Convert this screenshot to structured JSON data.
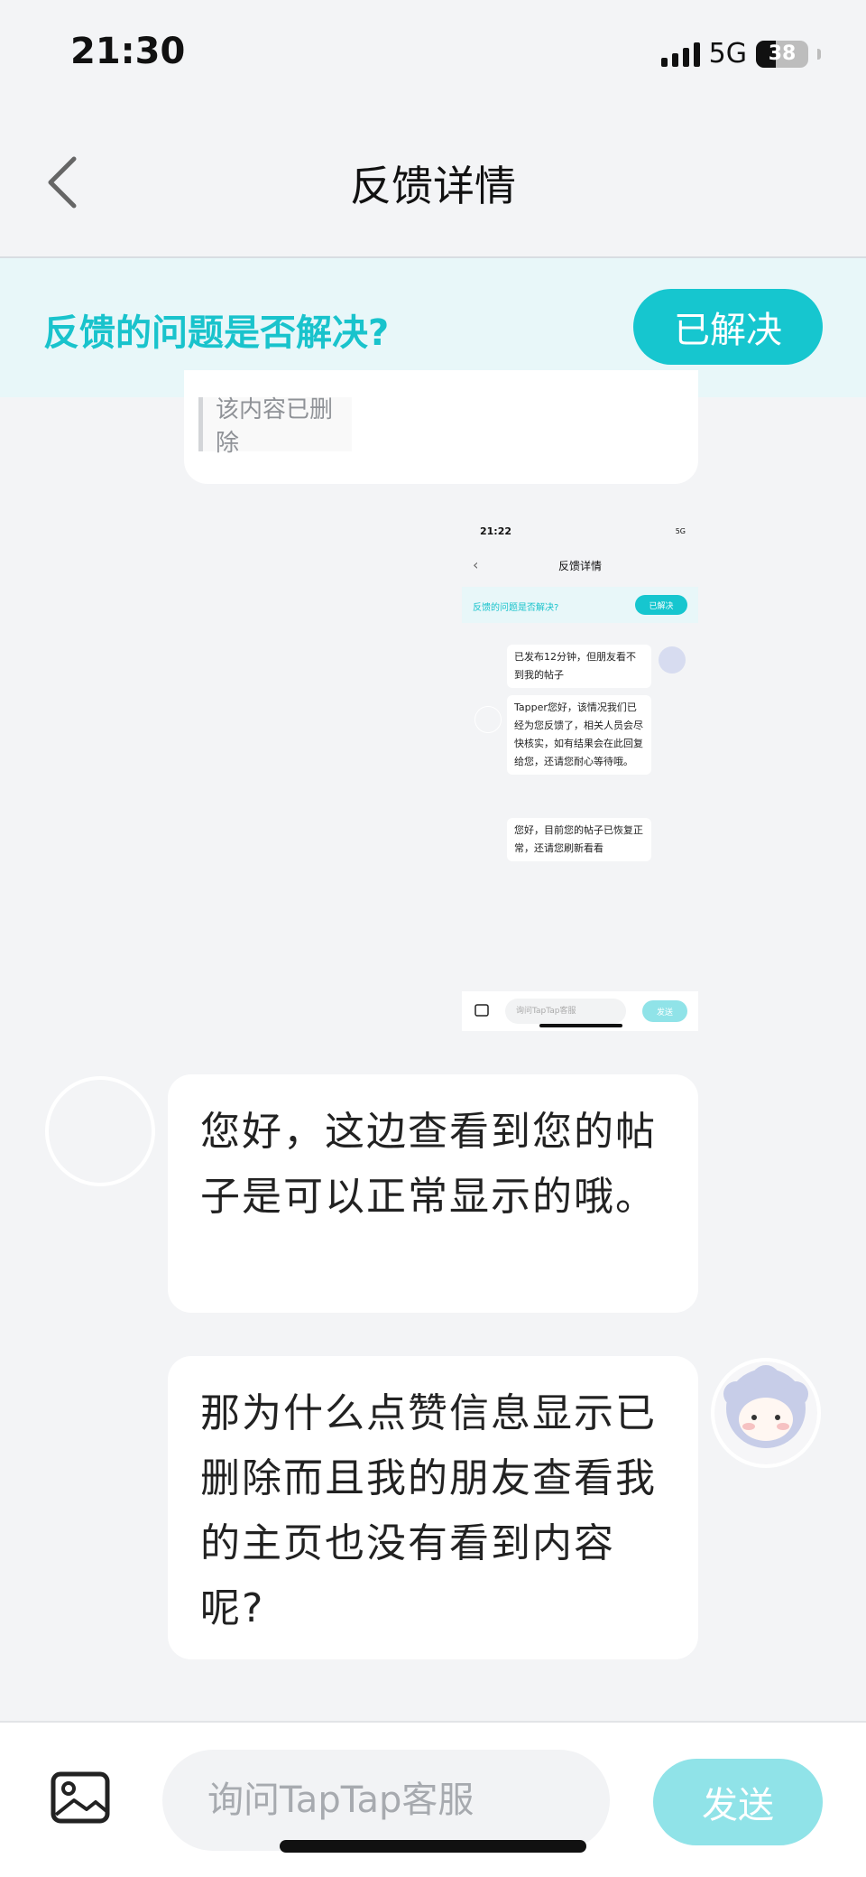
{
  "status_bar": {
    "time": "21:30",
    "network": "5G",
    "battery": "38"
  },
  "header": {
    "title": "反馈详情",
    "back_icon": "chevron-left-icon"
  },
  "banner": {
    "question": "反馈的问题是否解决?",
    "resolved_label": "已解决",
    "accent": "#16c6cf"
  },
  "messages": {
    "deleted_notice": "该内容已删除",
    "screenshot": {
      "time": "21:22",
      "network": "5G",
      "title": "反馈详情",
      "question": "反馈的问题是否解决?",
      "resolved_label": "已解决",
      "msg1": "已发布12分钟，但朋友看不到我的帖子",
      "msg2": "Tapper您好，该情况我们已经为您反馈了，相关人员会尽快核实，如有结果会在此回复给您，还请您耐心等待哦。",
      "msg3": "您好，目前您的帖子已恢复正常，还请您刷新看看",
      "input_placeholder": "询问TapTap客服",
      "send_label": "发送"
    },
    "agent_reply": "您好，这边查看到您的帖子是可以正常显示的哦。",
    "user_reply": "那为什么点赞信息显示已删除而且我的朋友查看我的主页也没有看到内容呢?"
  },
  "bottom_bar": {
    "image_icon": "image-icon",
    "input_placeholder": "询问TapTap客服",
    "send_label": "发送",
    "send_color": "#90e3e8"
  }
}
